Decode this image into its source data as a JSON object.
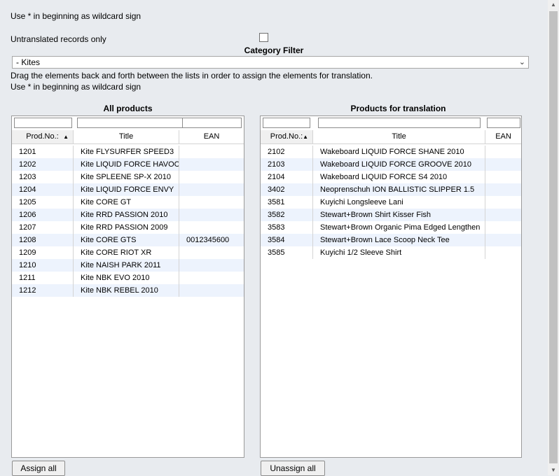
{
  "wildcard_hint_top": "Use * in beginning as wildcard sign",
  "untranslated_label": "Untranslated records only",
  "untranslated_checked": false,
  "category_filter_label": "Category Filter",
  "category_selected": "- Kites",
  "drag_hint": "Drag the elements back and forth between the lists in order to assign the elements for translation.",
  "wildcard_hint_bottom": "Use * in beginning as wildcard sign",
  "left_list": {
    "title": "All products",
    "columns": [
      "Prod.No.:",
      "Title",
      "EAN"
    ],
    "rows": [
      {
        "no": "1201",
        "title": "Kite FLYSURFER SPEED3",
        "ean": ""
      },
      {
        "no": "1202",
        "title": "Kite LIQUID FORCE HAVOC",
        "ean": ""
      },
      {
        "no": "1203",
        "title": "Kite SPLEENE SP-X 2010",
        "ean": ""
      },
      {
        "no": "1204",
        "title": "Kite LIQUID FORCE ENVY",
        "ean": ""
      },
      {
        "no": "1205",
        "title": "Kite CORE GT",
        "ean": ""
      },
      {
        "no": "1206",
        "title": "Kite RRD PASSION 2010",
        "ean": ""
      },
      {
        "no": "1207",
        "title": "Kite RRD PASSION 2009",
        "ean": ""
      },
      {
        "no": "1208",
        "title": "Kite CORE GTS",
        "ean": "0012345600"
      },
      {
        "no": "1209",
        "title": "Kite CORE RIOT XR",
        "ean": ""
      },
      {
        "no": "1210",
        "title": "Kite NAISH PARK 2011",
        "ean": ""
      },
      {
        "no": "1211",
        "title": "Kite NBK EVO 2010",
        "ean": ""
      },
      {
        "no": "1212",
        "title": "Kite NBK REBEL 2010",
        "ean": ""
      }
    ],
    "button_label": "Assign all"
  },
  "right_list": {
    "title": "Products for translation",
    "columns": [
      "Prod.No.:",
      "Title",
      "EAN"
    ],
    "rows": [
      {
        "no": "2102",
        "title": "Wakeboard LIQUID FORCE SHANE 2010",
        "ean": ""
      },
      {
        "no": "2103",
        "title": "Wakeboard LIQUID FORCE GROOVE 2010",
        "ean": ""
      },
      {
        "no": "2104",
        "title": "Wakeboard LIQUID FORCE S4 2010",
        "ean": ""
      },
      {
        "no": "3402",
        "title": "Neoprenschuh ION BALLISTIC SLIPPER 1.5",
        "ean": ""
      },
      {
        "no": "3581",
        "title": "Kuyichi Longsleeve Lani",
        "ean": ""
      },
      {
        "no": "3582",
        "title": "Stewart+Brown Shirt Kisser Fish",
        "ean": ""
      },
      {
        "no": "3583",
        "title": "Stewart+Brown Organic Pima Edged Lengthen",
        "ean": ""
      },
      {
        "no": "3584",
        "title": "Stewart+Brown Lace Scoop Neck Tee",
        "ean": ""
      },
      {
        "no": "3585",
        "title": "Kuyichi 1/2 Sleeve Shirt",
        "ean": ""
      }
    ],
    "button_label": "Unassign all"
  },
  "colors": {
    "page_bg": "#e8ebef",
    "row_alt": "#edf3fd",
    "border": "#9a9a9a"
  }
}
